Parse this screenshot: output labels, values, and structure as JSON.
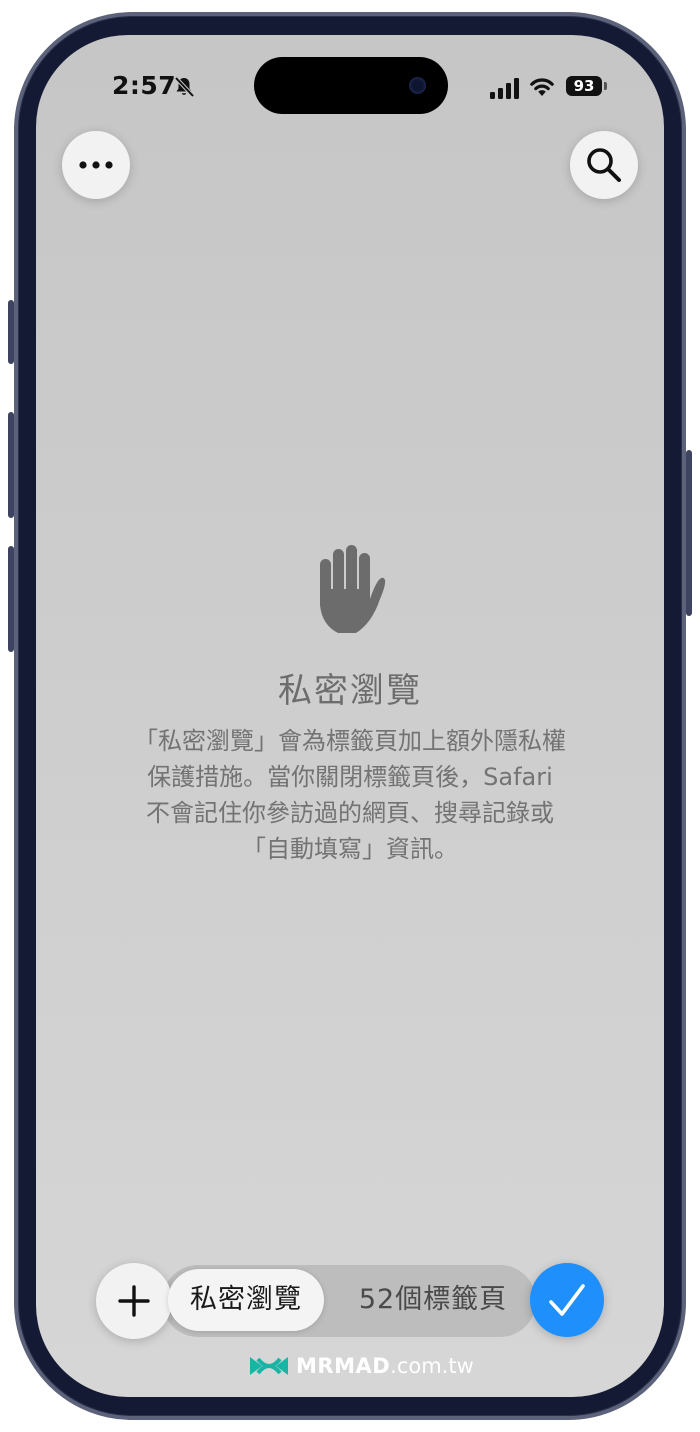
{
  "status_bar": {
    "time": "2:57",
    "battery_level": "93",
    "silent_icon": "bell-slash-icon",
    "signal_icon": "cellular-signal-icon",
    "wifi_icon": "wifi-icon"
  },
  "toolbar": {
    "more_icon": "ellipsis-icon",
    "search_icon": "magnifier-icon"
  },
  "private_page": {
    "icon": "hand-raised-icon",
    "title": "私密瀏覽",
    "description_lines": [
      "「私密瀏覽」會為標籤頁加上額外隱私權",
      "保護措施。當你關閉標籤頁後，Safari",
      "不會記住你參訪過的網頁、搜尋記錄或",
      "「自動填寫」資訊。"
    ]
  },
  "bottom_bar": {
    "add_icon": "plus-icon",
    "segments": [
      {
        "label": "私密瀏覽",
        "selected": true
      },
      {
        "label": "52個標籤頁",
        "selected": false
      }
    ],
    "done_icon": "checkmark-icon",
    "accent_color": "#1e8ffb"
  },
  "watermark": {
    "brand": "MRMAD",
    "domain": ".com.tw",
    "color": "#19b5a4"
  }
}
